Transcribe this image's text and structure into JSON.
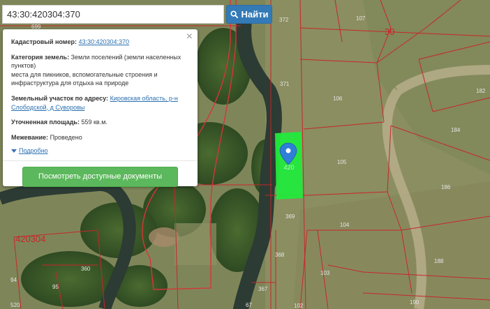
{
  "search": {
    "value": "43:30:420304:370",
    "button_label": "Найти"
  },
  "popup": {
    "cadastral_label": "Кадастровый номер:",
    "cadastral_value": "43:30:420304:370",
    "category_label": "Категория земель:",
    "category_value": "Земли поселений (земли населенных пунктов)",
    "category_purpose": "места для пикников, вспомогательные строения и инфраструктура для отдыха на природе",
    "address_label": "Земельный участок по адресу:",
    "address_value": "Кировская область, р-н Слободской, д Суворовы",
    "area_label": "Уточненная площадь:",
    "area_value": "559 кв.м.",
    "survey_label": "Межевание:",
    "survey_value": "Проведено",
    "more_label": "Подробно",
    "docs_button": "Посмотреть доступные документы"
  },
  "map": {
    "parcel_numbers": [
      "699",
      "372",
      "107",
      "30",
      "371",
      "106",
      "182",
      "184",
      "105",
      "186",
      "369",
      "104",
      "420304",
      "368",
      "360",
      "188",
      "103",
      "94",
      "95",
      "367",
      "102",
      "190",
      "67",
      "520"
    ],
    "colors": {
      "parcel_border": "#c8262b",
      "selected_parcel": "#22ea3c",
      "marker": "#2f7ed8",
      "search_button": "#337ab7",
      "docs_button": "#5cb85c"
    }
  }
}
